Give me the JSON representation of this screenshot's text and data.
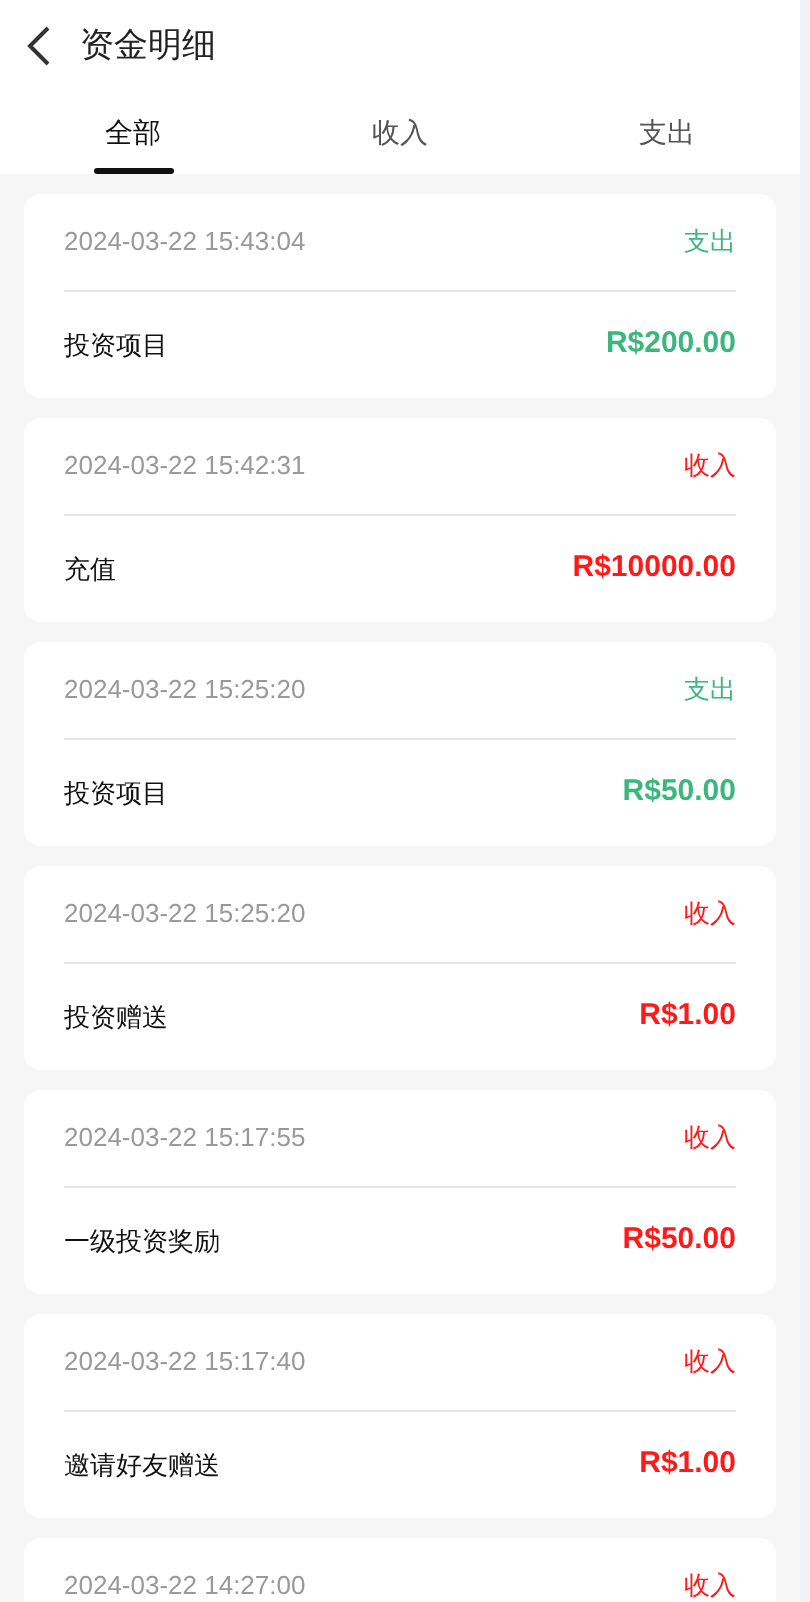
{
  "header": {
    "title": "资金明细"
  },
  "tabs": [
    {
      "label": "全部",
      "selected": true
    },
    {
      "label": "收入",
      "selected": false
    },
    {
      "label": "支出",
      "selected": false
    }
  ],
  "records": [
    {
      "time": "2024-03-22 15:43:04",
      "type": "支出",
      "kind": "expense",
      "name": "投资项目",
      "amount": "R$200.00"
    },
    {
      "time": "2024-03-22 15:42:31",
      "type": "收入",
      "kind": "income",
      "name": "充值",
      "amount": "R$10000.00"
    },
    {
      "time": "2024-03-22 15:25:20",
      "type": "支出",
      "kind": "expense",
      "name": "投资项目",
      "amount": "R$50.00"
    },
    {
      "time": "2024-03-22 15:25:20",
      "type": "收入",
      "kind": "income",
      "name": "投资赠送",
      "amount": "R$1.00"
    },
    {
      "time": "2024-03-22 15:17:55",
      "type": "收入",
      "kind": "income",
      "name": "一级投资奖励",
      "amount": "R$50.00"
    },
    {
      "time": "2024-03-22 15:17:40",
      "type": "收入",
      "kind": "income",
      "name": "邀请好友赠送",
      "amount": "R$1.00"
    },
    {
      "time": "2024-03-22 14:27:00",
      "type": "收入",
      "kind": "income"
    }
  ]
}
